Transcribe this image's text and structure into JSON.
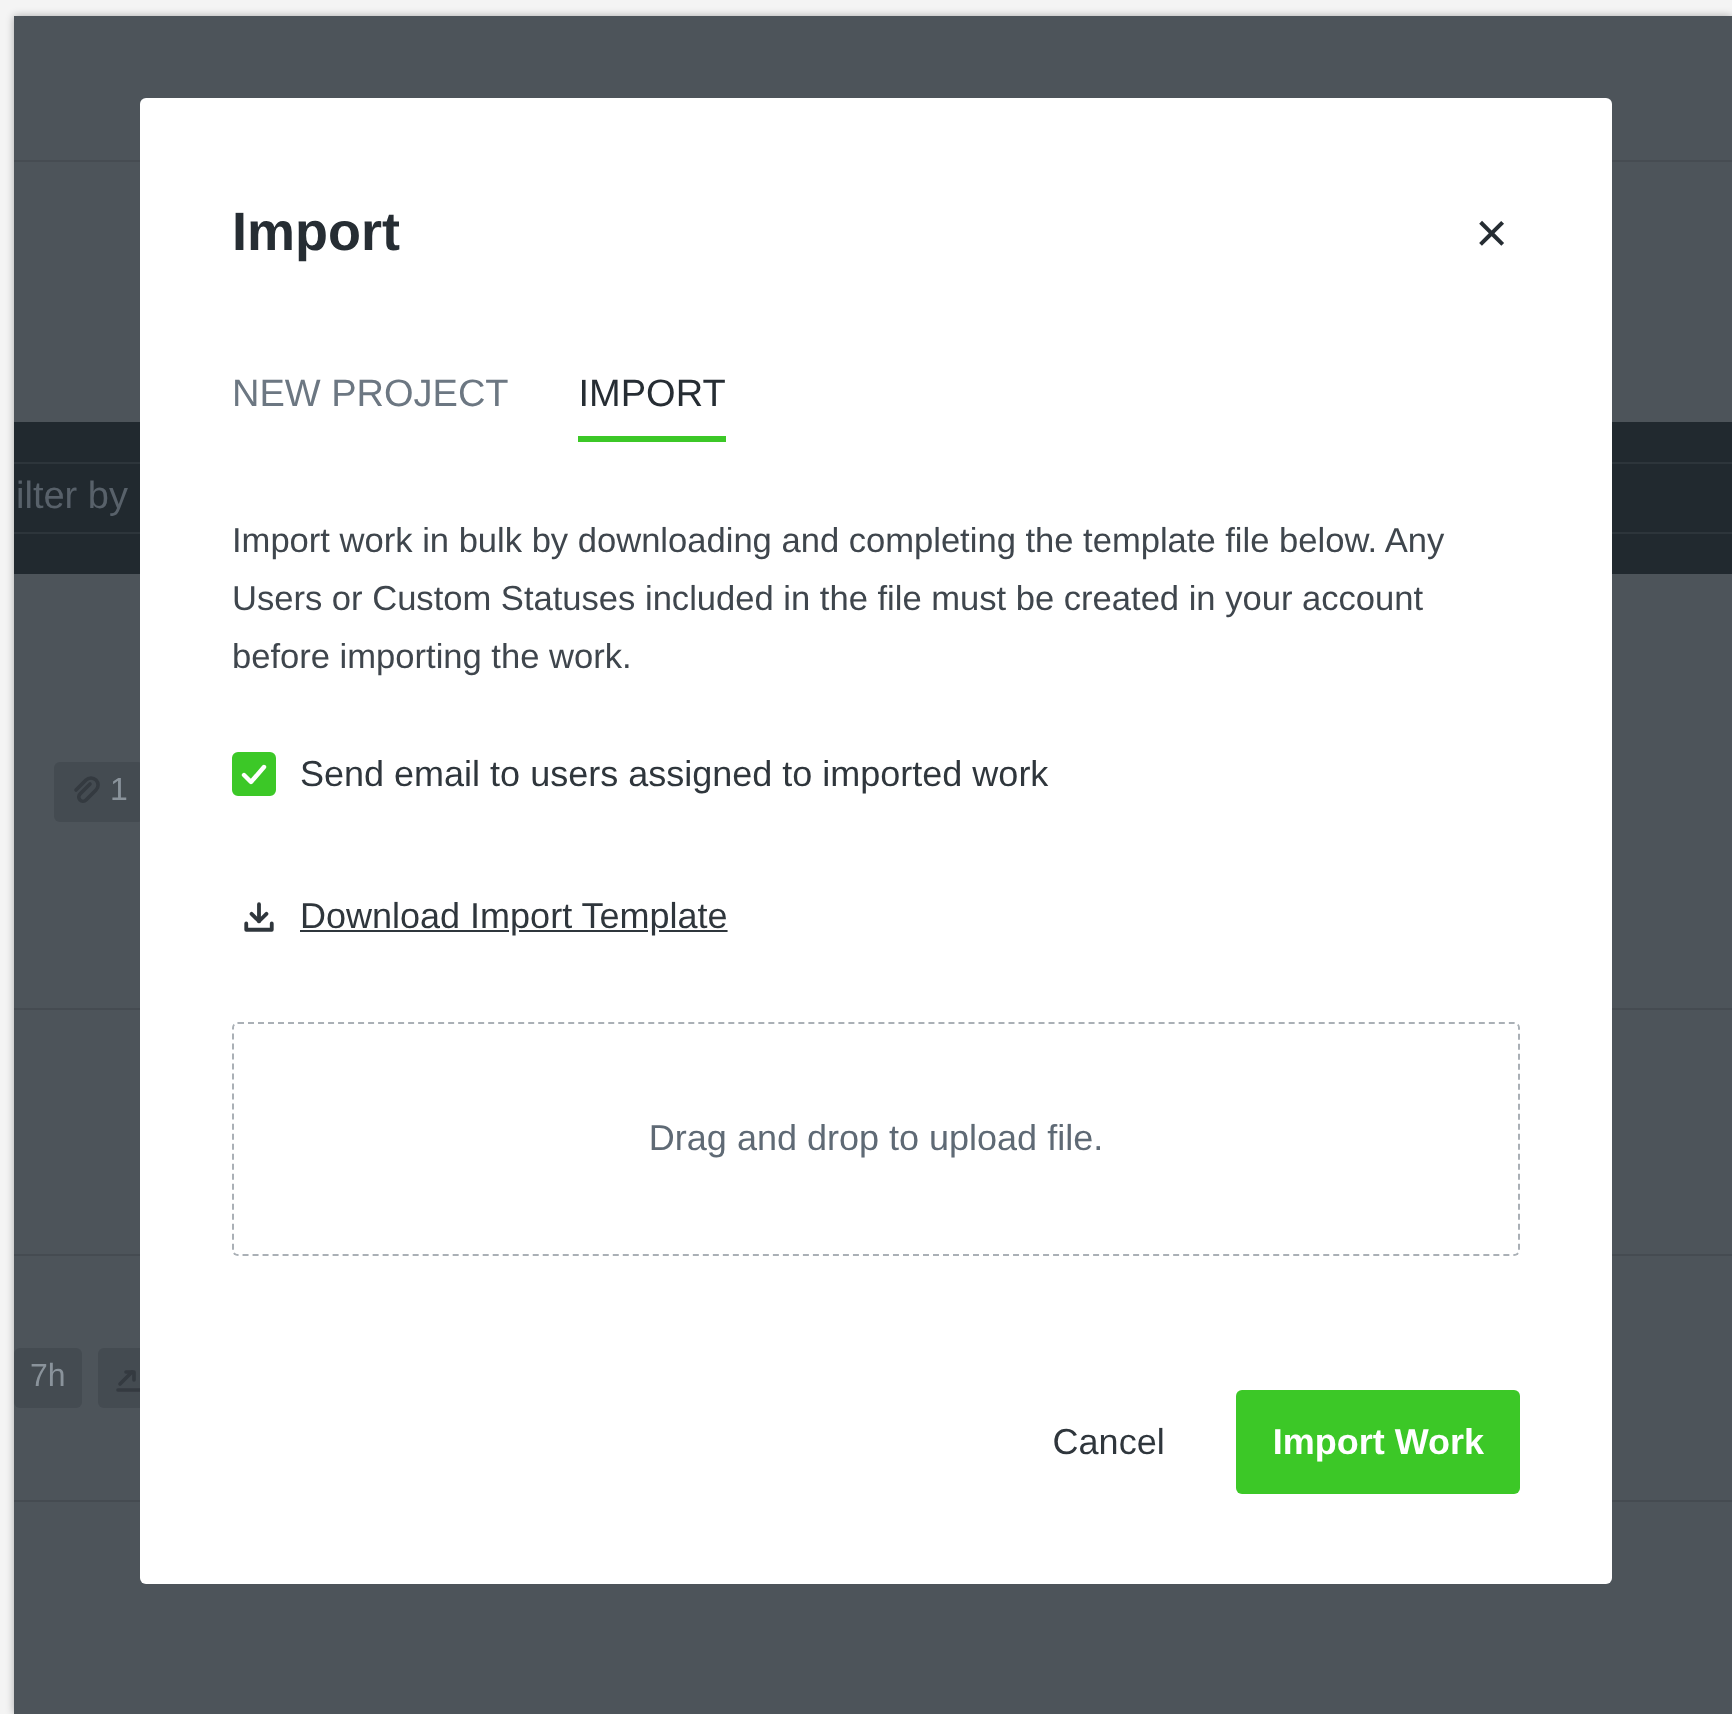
{
  "background": {
    "filter_text": "ilter by",
    "chips": [
      {
        "kind": "link",
        "text": "1"
      },
      {
        "kind": "time",
        "text": "7h"
      },
      {
        "kind": "trend"
      }
    ]
  },
  "dialog": {
    "title": "Import",
    "close_label": "×",
    "tabs": [
      {
        "label": "NEW PROJECT",
        "selected": false
      },
      {
        "label": "IMPORT",
        "selected": true
      }
    ],
    "description": "Import work in bulk by downloading and completing the template file below. Any Users or Custom Statuses included in the file must be created in your account before importing the work.",
    "notify_checkbox": {
      "label": "Send email to users assigned to imported work",
      "checked": true
    },
    "download_link": "Download Import Template",
    "dropzone_text": "Drag and drop to upload file.",
    "buttons": [
      {
        "kind": "secondary",
        "label": "Cancel"
      },
      {
        "kind": "primary",
        "label": "Import Work"
      }
    ]
  }
}
